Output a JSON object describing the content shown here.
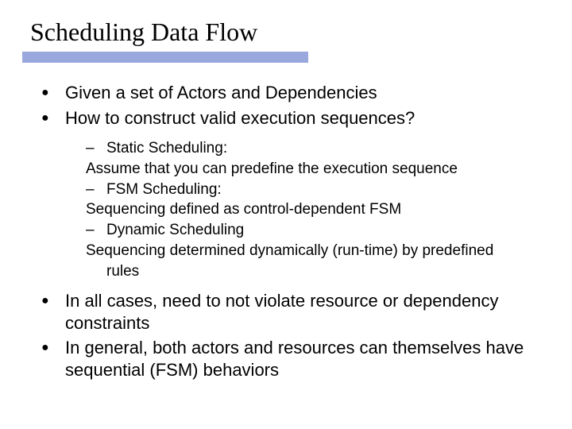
{
  "title": "Scheduling Data Flow",
  "bullets1": [
    "Given a set of Actors and Dependencies",
    "How to construct valid execution sequences?"
  ],
  "subs": [
    "Static Scheduling:",
    "Assume that you can predefine the execution sequence",
    "FSM Scheduling:",
    "Sequencing defined as control-dependent FSM",
    "Dynamic Scheduling",
    "Sequencing determined dynamically (run-time) by predefined",
    "rules"
  ],
  "bullets2": [
    "In all cases, need to not violate resource or dependency constraints",
    "In general, both actors and resources can themselves have sequential (FSM) behaviors"
  ],
  "colors": {
    "rule": "#9aa8de"
  }
}
